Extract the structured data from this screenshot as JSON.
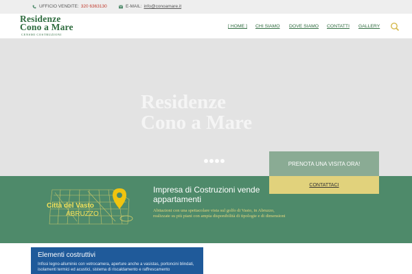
{
  "topbar": {
    "phone_label": "UFFICIO VENDITE:",
    "phone_number": "320 6363130",
    "email_label": "E-MAIL:",
    "email_address": "info@conoamare.it"
  },
  "logo": {
    "line1": "Residenze",
    "line2": "Cono a Mare",
    "line3": "CENSMI COSTRUZIONI"
  },
  "nav": {
    "items": [
      {
        "label": "[ HOME ]"
      },
      {
        "label": "CHI SIAMO"
      },
      {
        "label": "DOVE SIAMO"
      },
      {
        "label": "CONTATTI"
      },
      {
        "label": "GALLERY"
      }
    ]
  },
  "hero": {
    "title_line1": "Residenze",
    "title_line2": "Cono a Mare"
  },
  "cta": {
    "prenota": "PRENOTA UNA VISITA ORA!",
    "contattaci": "CONTATTACI"
  },
  "band": {
    "map_title": "Città del Vasto",
    "map_subtitle": "ABRUZZO",
    "title": "Impresa di Costruzioni vende appartamenti",
    "text": "Abitazioni con una spettacolare vista sul golfo di Vasto, in Abruzzo, realizzate su più piani con ampia disponibilità di tipologie e di dimensioni"
  },
  "card": {
    "title": "Elementi costruttivi",
    "text": "Infissi legno-alluminio con vetrocamera, aperture anche a vasistas, portoncini blindati, isolamenti termici ed acustici, sistema di riscaldamento e raffrescamento"
  },
  "colors": {
    "brand_green": "#2e6b3e",
    "band_green": "#4e8a6a",
    "cta_green": "#8aab94",
    "cta_yellow": "#e1d27c",
    "card_blue": "#1f5a9a",
    "accent_red": "#c0392b"
  },
  "icons": {
    "phone": "phone-icon",
    "mail": "mail-icon",
    "search": "search-icon",
    "map_pin": "map-pin-icon"
  }
}
